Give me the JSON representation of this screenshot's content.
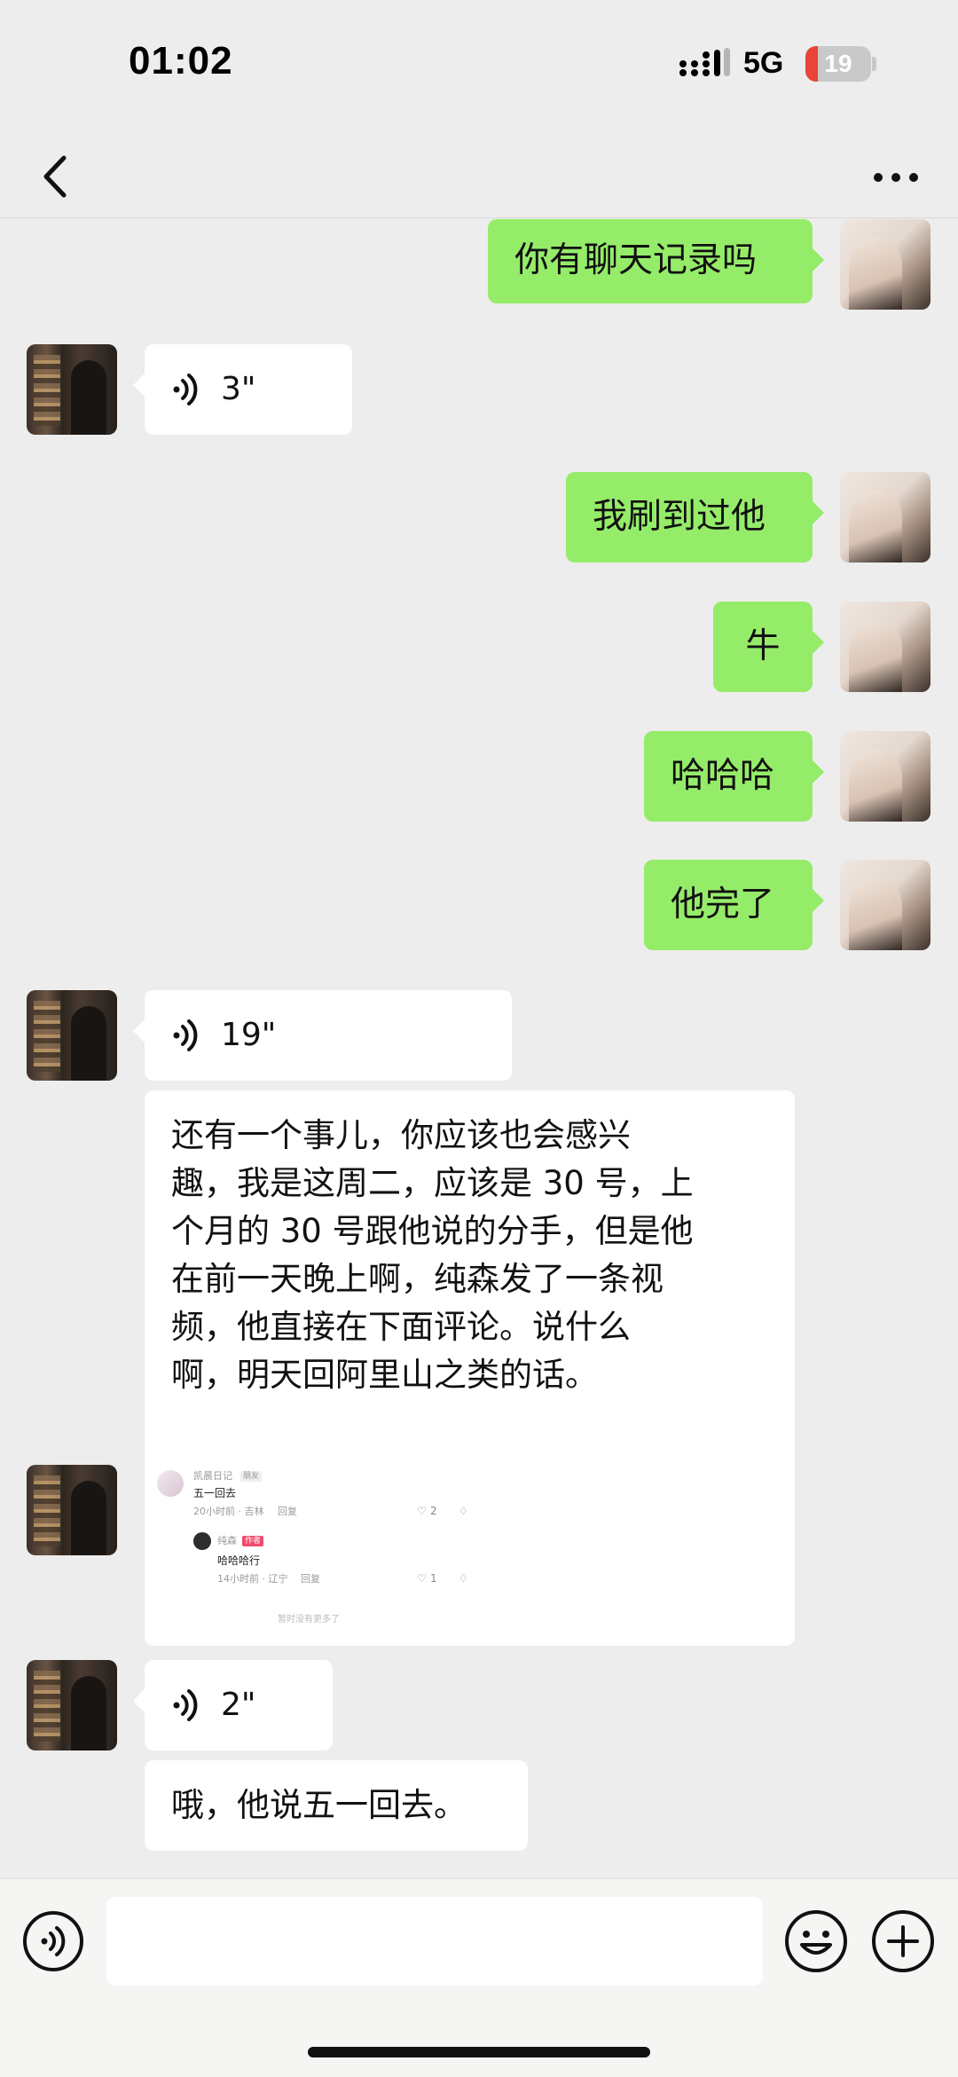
{
  "status_bar": {
    "time": "01:02",
    "network": "5G",
    "battery_level": "19",
    "battery_fraction": 0.19
  },
  "nav": {
    "back_icon": "chevron-left-icon",
    "more_icon": "more-dots-icon"
  },
  "messages": [
    {
      "side": "out",
      "type": "text",
      "text": "你有聊天记录吗"
    },
    {
      "side": "in",
      "type": "voice",
      "duration": "3\""
    },
    {
      "side": "out",
      "type": "text",
      "text": "我刷到过他"
    },
    {
      "side": "out",
      "type": "text",
      "text": "牛"
    },
    {
      "side": "out",
      "type": "text",
      "text": "哈哈哈"
    },
    {
      "side": "out",
      "type": "text",
      "text": "他完了"
    },
    {
      "side": "in",
      "type": "voice",
      "duration": "19\""
    },
    {
      "side": "in",
      "type": "text",
      "lines": [
        "还有一个事儿，你应该也会感兴",
        "趣，我是这周二，应该是 30 号，上",
        "个月的 30 号跟他说的分手，但是他",
        "在前一天晚上啊，纯森发了一条视",
        "频，他直接在下面评论。说什么",
        "啊，明天回阿里山之类的话。"
      ]
    },
    {
      "side": "in",
      "type": "image",
      "shared_comment": {
        "comment_user": "凯晨日记",
        "comment_badge": "朋友",
        "comment_text": "五一回去",
        "comment_meta": "20小时前 · 吉林",
        "comment_reply": "回复",
        "comment_likes": "2",
        "reply_user": "纯森",
        "reply_badge": "作者",
        "reply_text": "哈哈哈行",
        "reply_meta": "14小时前 · 辽宁",
        "reply_reply": "回复",
        "reply_likes": "1",
        "cutoff_text": "暂时没有更多了"
      }
    },
    {
      "side": "in",
      "type": "voice",
      "duration": "2\""
    },
    {
      "side": "in",
      "type": "text",
      "text": "哦，他说五一回去。"
    }
  ],
  "input_bar": {
    "voice_icon": "voice-mode-icon",
    "emoji_icon": "emoji-icon",
    "plus_icon": "plus-icon",
    "input_value": ""
  },
  "colors": {
    "outgoing_bubble": "#95ec69",
    "incoming_bubble": "#ffffff",
    "background": "#ededed",
    "battery_low": "#e8443a"
  }
}
